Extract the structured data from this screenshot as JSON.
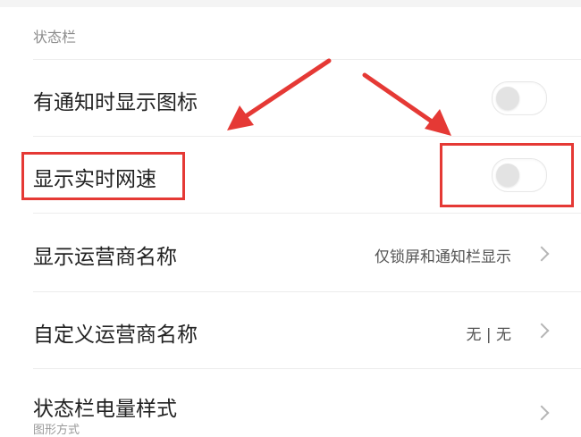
{
  "section": {
    "header": "状态栏"
  },
  "rows": [
    {
      "label": "有通知时显示图标",
      "control": "toggle",
      "enabled": false
    },
    {
      "label": "显示实时网速",
      "control": "toggle",
      "enabled": false
    },
    {
      "label": "显示运营商名称",
      "value": "仅锁屏和通知栏显示",
      "control": "chevron"
    },
    {
      "label": "自定义运营商名称",
      "value": "无 | 无",
      "control": "chevron"
    },
    {
      "label": "状态栏电量样式",
      "subtext": "图形方式",
      "control": "chevron"
    }
  ],
  "colors": {
    "annotation": "#e53935",
    "divider": "#ececec",
    "toggle_knob": "#e3e3e3"
  }
}
